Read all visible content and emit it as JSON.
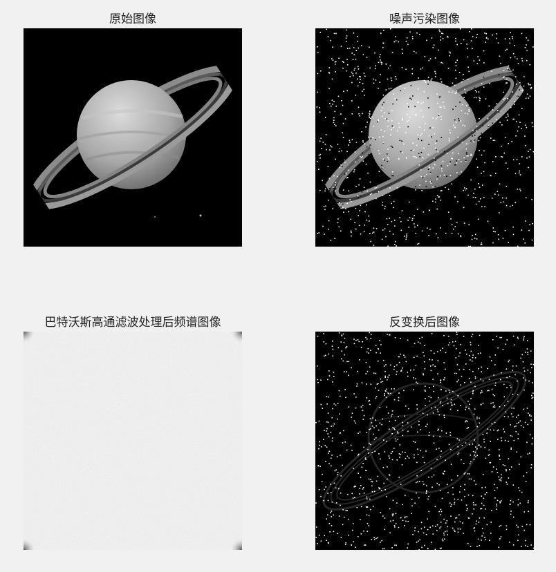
{
  "figure": {
    "background_color": "#f0f0f0",
    "panels": [
      {
        "id": "original",
        "title": "原始图像"
      },
      {
        "id": "noisy",
        "title": "噪声污染图像"
      },
      {
        "id": "spectrum",
        "title": "巴特沃斯高通滤波处理后频谱图像"
      },
      {
        "id": "inverse",
        "title": "反变换后图像"
      }
    ]
  }
}
